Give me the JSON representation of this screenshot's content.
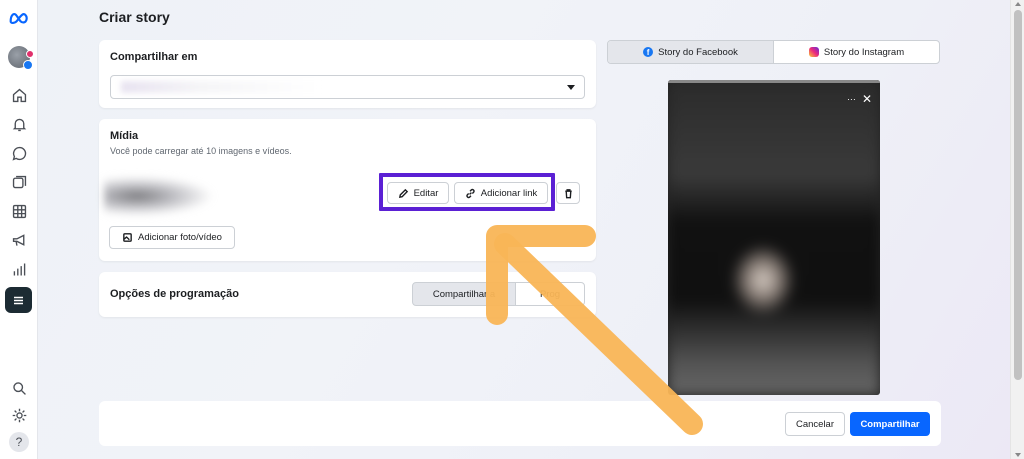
{
  "page": {
    "title": "Criar story"
  },
  "nav": {
    "icons": [
      "meta-logo-icon",
      "home-icon",
      "bell-icon",
      "chat-icon",
      "pages-icon",
      "table-icon",
      "megaphone-icon",
      "chart-icon",
      "menu-icon",
      "search-icon",
      "gear-icon",
      "help-icon"
    ],
    "help_label": "?"
  },
  "share_in": {
    "title": "Compartilhar em"
  },
  "media": {
    "title": "Mídia",
    "subtitle": "Você pode carregar até 10 imagens e vídeos.",
    "edit_label": "Editar",
    "add_link_label": "Adicionar link",
    "add_media_label": "Adicionar foto/vídeo"
  },
  "schedule": {
    "title": "Opções de programação",
    "option_now": "Compartilhar a",
    "option_schedule": "Prog"
  },
  "preview": {
    "tab_facebook": "Story do Facebook",
    "tab_instagram": "Story do Instagram",
    "more_label": "···",
    "close_label": "✕"
  },
  "footer": {
    "cancel_label": "Cancelar",
    "share_label": "Compartilhar"
  },
  "colors": {
    "highlight": "#5b20d4",
    "arrow": "#f9b556",
    "primary": "#0866ff",
    "nav_active": "#1c2b33"
  }
}
